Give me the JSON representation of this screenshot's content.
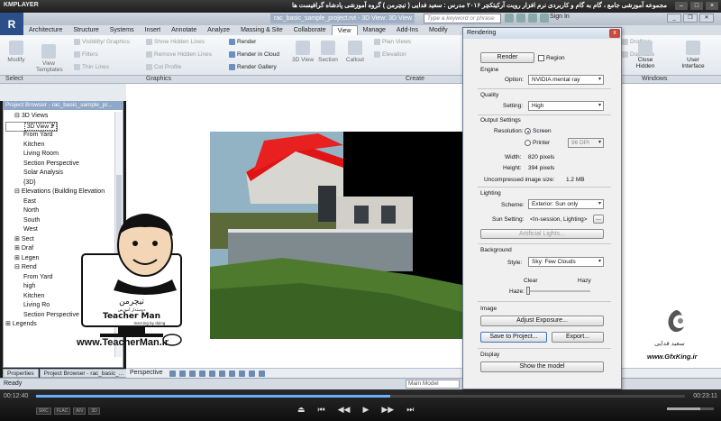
{
  "player": {
    "brand": "KMPLAYER",
    "caption": "مجموعه آموزشی جامع ، گام به گام و کاربردی نرم افزار رویت آرکیتکچر ۲۰۱۶ مدرس : سعید فدایی ( تیچرمن ) گروه آموزشی پادشاه گرافیست ها",
    "time_elapsed": "00:12:40",
    "time_total": "00:23:11",
    "progress": 0.546,
    "volume": 0.72,
    "badges": [
      "SRC",
      "FLAC",
      "A/V",
      "3D"
    ],
    "controls": [
      "⏏",
      "⏮",
      "◀◀",
      "▶",
      "▶▶",
      "⏭"
    ]
  },
  "revit": {
    "logo": "R",
    "doc_title": "rac_basic_sample_project.rvt - 3D View: 3D View 1",
    "search_placeholder": "Type a keyword or phrase",
    "sign_in": "Sign In",
    "tabs": [
      "Architecture",
      "Structure",
      "Systems",
      "Insert",
      "Annotate",
      "Analyze",
      "Massing & Site",
      "Collaborate",
      "View",
      "Manage",
      "Add-Ins",
      "Modify"
    ],
    "active_tab": "View",
    "ribbon": {
      "modify": "Modify",
      "view_templates": "View Templates",
      "visibility_graphics": "Visibility/ Graphics",
      "filters": "Filters",
      "thin_lines": "Thin Lines",
      "show_hidden_lines": "Show Hidden Lines",
      "remove_hidden_lines": "Remove Hidden Lines",
      "cut_profile": "Cut Profile",
      "render": "Render",
      "render_in_cloud": "Render in Cloud",
      "render_gallery": "Render Gallery",
      "three_d_view": "3D View",
      "section": "Section",
      "callout": "Callout",
      "plan_views": "Plan Views",
      "elevation": "Elevation",
      "drafting": "Drafting",
      "duplicate": "Duplicate",
      "close_hidden": "Close Hidden",
      "user_interface": "User Interface",
      "groups": {
        "select": "Select",
        "graphics": "Graphics",
        "create": "Create",
        "windows": "Windows"
      }
    },
    "project_browser": {
      "title": "Project Browser - rac_basic_sample_pr...",
      "items": [
        {
          "label": "3D Views",
          "indent": 1,
          "prefix": "⊟"
        },
        {
          "label": "3D View 1",
          "indent": 2,
          "prefix": "",
          "selected": true
        },
        {
          "label": "Approach",
          "indent": 2,
          "prefix": ""
        },
        {
          "label": "From Yard",
          "indent": 2,
          "prefix": ""
        },
        {
          "label": "Kitchen",
          "indent": 2,
          "prefix": ""
        },
        {
          "label": "Living Room",
          "indent": 2,
          "prefix": ""
        },
        {
          "label": "Section Perspective",
          "indent": 2,
          "prefix": ""
        },
        {
          "label": "Solar Analysis",
          "indent": 2,
          "prefix": ""
        },
        {
          "label": "{3D}",
          "indent": 2,
          "prefix": ""
        },
        {
          "label": "Elevations (Building Elevation",
          "indent": 1,
          "prefix": "⊟"
        },
        {
          "label": "East",
          "indent": 2,
          "prefix": ""
        },
        {
          "label": "North",
          "indent": 2,
          "prefix": ""
        },
        {
          "label": "South",
          "indent": 2,
          "prefix": ""
        },
        {
          "label": "West",
          "indent": 2,
          "prefix": ""
        },
        {
          "label": "Sect",
          "indent": 1,
          "prefix": "⊞"
        },
        {
          "label": "Draf",
          "indent": 1,
          "prefix": "⊞"
        },
        {
          "label": "Legen",
          "indent": 1,
          "prefix": "⊞"
        },
        {
          "label": "Rend",
          "indent": 1,
          "prefix": "⊟"
        },
        {
          "label": "",
          "indent": 2,
          "prefix": ""
        },
        {
          "label": "From Yard",
          "indent": 2,
          "prefix": ""
        },
        {
          "label": "high",
          "indent": 2,
          "prefix": ""
        },
        {
          "label": "Kitchen",
          "indent": 2,
          "prefix": ""
        },
        {
          "label": "Living Ro",
          "indent": 2,
          "prefix": ""
        },
        {
          "label": "Section Perspective",
          "indent": 2,
          "prefix": ""
        },
        {
          "label": "Legends",
          "indent": 0,
          "prefix": "⊞"
        }
      ],
      "tabs": [
        "Properties",
        "Project Browser - rac_basic_..."
      ]
    },
    "view_bar_label": "Perspective",
    "status": "Ready",
    "status_model": "Main Model"
  },
  "dialog": {
    "title": "Rendering",
    "close": "x",
    "render_button": "Render",
    "region": "Region",
    "engine_section": "Engine",
    "option_label": "Option:",
    "option_value": "NVIDIA mental ray",
    "quality_section": "Quality",
    "setting_label": "Setting:",
    "setting_value": "High",
    "output_section": "Output Settings",
    "resolution_label": "Resolution:",
    "screen": "Screen",
    "printer": "Printer",
    "dpi": "96 DPI",
    "width_label": "Width:",
    "width_value": "820 pixels",
    "height_label": "Height:",
    "height_value": "394 pixels",
    "size_label": "Uncompressed image size:",
    "size_value": "1.2 MB",
    "lighting_section": "Lighting",
    "scheme_label": "Scheme:",
    "scheme_value": "Exterior: Sun only",
    "sun_label": "Sun Setting:",
    "sun_value": "<In-session, Lighting>",
    "sun_more": "...",
    "artificial_lights": "Artificial Lights...",
    "background_section": "Background",
    "style_label": "Style:",
    "style_value": "Sky: Few Clouds",
    "clear": "Clear",
    "hazy": "Hazy",
    "haze_label": "Haze:",
    "image_section": "Image",
    "adjust_exposure": "Adjust Exposure...",
    "save_to_project": "Save to Project...",
    "export": "Export...",
    "display_section": "Display",
    "show_model": "Show the model"
  },
  "watermark": {
    "brand_fa": "تیچرمن",
    "tagline_fa": "دوستدار آموزش",
    "brand_en": "Teacher Man",
    "tagline_en": "learning by doing",
    "url": "www.TeacherMan.ir"
  },
  "gfxking": {
    "name_fa": "سعید فدایی",
    "url": "www.GfxKing.ir"
  },
  "colors": {
    "roof": "#e01414",
    "ribbon_active": "#ffffff",
    "dialog_bg": "#f0f0f0",
    "browser_header": "#8fa8c8"
  }
}
